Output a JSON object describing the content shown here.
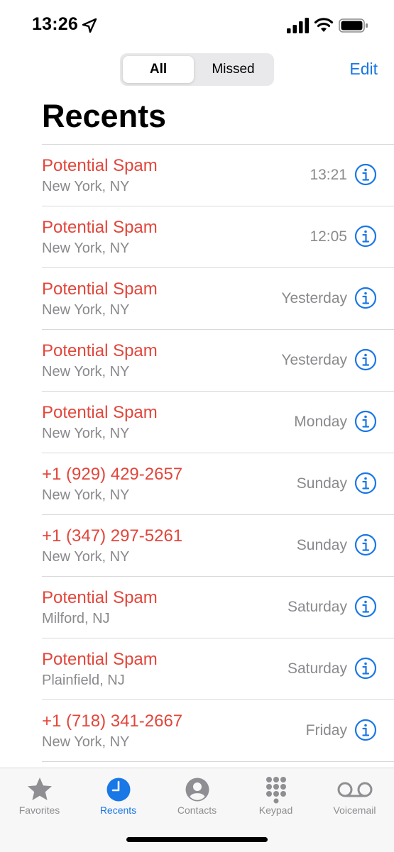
{
  "status_bar": {
    "time": "13:26",
    "location_icon": "location-arrow-icon",
    "signal_icon": "cellular-signal-icon",
    "wifi_icon": "wifi-icon",
    "battery_icon": "battery-icon"
  },
  "header": {
    "segments": [
      "All",
      "Missed"
    ],
    "selected_segment": "All",
    "edit_label": "Edit",
    "title": "Recents"
  },
  "colors": {
    "accent": "#1977e6",
    "missed_red": "#e2463b",
    "secondary_text": "#8a8a8e"
  },
  "calls": [
    {
      "name": "Potential Spam",
      "location": "New York, NY",
      "time": "13:21"
    },
    {
      "name": "Potential Spam",
      "location": "New York, NY",
      "time": "12:05"
    },
    {
      "name": "Potential Spam",
      "location": "New York, NY",
      "time": "Yesterday"
    },
    {
      "name": "Potential Spam",
      "location": "New York, NY",
      "time": "Yesterday"
    },
    {
      "name": "Potential Spam",
      "location": "New York, NY",
      "time": "Monday"
    },
    {
      "name": "+1 (929) 429-2657",
      "location": "New York, NY",
      "time": "Sunday"
    },
    {
      "name": "+1 (347) 297-5261",
      "location": "New York, NY",
      "time": "Sunday"
    },
    {
      "name": "Potential Spam",
      "location": "Milford, NJ",
      "time": "Saturday"
    },
    {
      "name": "Potential Spam",
      "location": "Plainfield, NJ",
      "time": "Saturday"
    },
    {
      "name": "+1 (718) 341-2667",
      "location": "New York, NY",
      "time": "Friday"
    }
  ],
  "tab_bar": {
    "items": [
      {
        "label": "Favorites",
        "icon": "star-icon",
        "active": false
      },
      {
        "label": "Recents",
        "icon": "clock-icon",
        "active": true
      },
      {
        "label": "Contacts",
        "icon": "person-circle-icon",
        "active": false
      },
      {
        "label": "Keypad",
        "icon": "keypad-icon",
        "active": false
      },
      {
        "label": "Voicemail",
        "icon": "voicemail-icon",
        "active": false
      }
    ]
  }
}
